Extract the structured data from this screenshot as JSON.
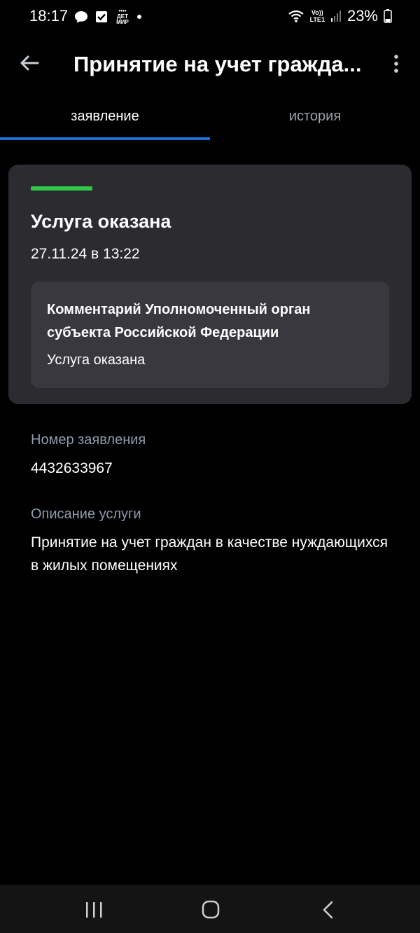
{
  "status_bar": {
    "time": "18:17",
    "app_icons": [
      "message-icon",
      "checkbox-icon",
      "detmir-icon"
    ],
    "detmir_label_top": "ДЕТ",
    "detmir_label_bottom": "МИР",
    "network": "LTE1",
    "volte": "Vo))",
    "battery": "23%"
  },
  "app_bar": {
    "title": "Принятие на учет гражда..."
  },
  "tabs": [
    {
      "label": "заявление",
      "active": true
    },
    {
      "label": "история",
      "active": false
    }
  ],
  "status_card": {
    "status": "Услуга оказана",
    "date": "27.11.24 в 13:22",
    "status_color": "#2ec84a",
    "comment_title": "Комментарий Уполномоченный орган субъекта Российской Федерации",
    "comment_text": "Услуга оказана"
  },
  "details": {
    "number_label": "Номер заявления",
    "number_value": "4432633967",
    "description_label": "Описание услуги",
    "description_value": "Принятие на учет граждан в качестве нуждающихся в жилых помещениях"
  },
  "colors": {
    "accent": "#1e6fd9",
    "background": "#000000",
    "card": "#2b2b30",
    "label": "#8e9cb0"
  }
}
